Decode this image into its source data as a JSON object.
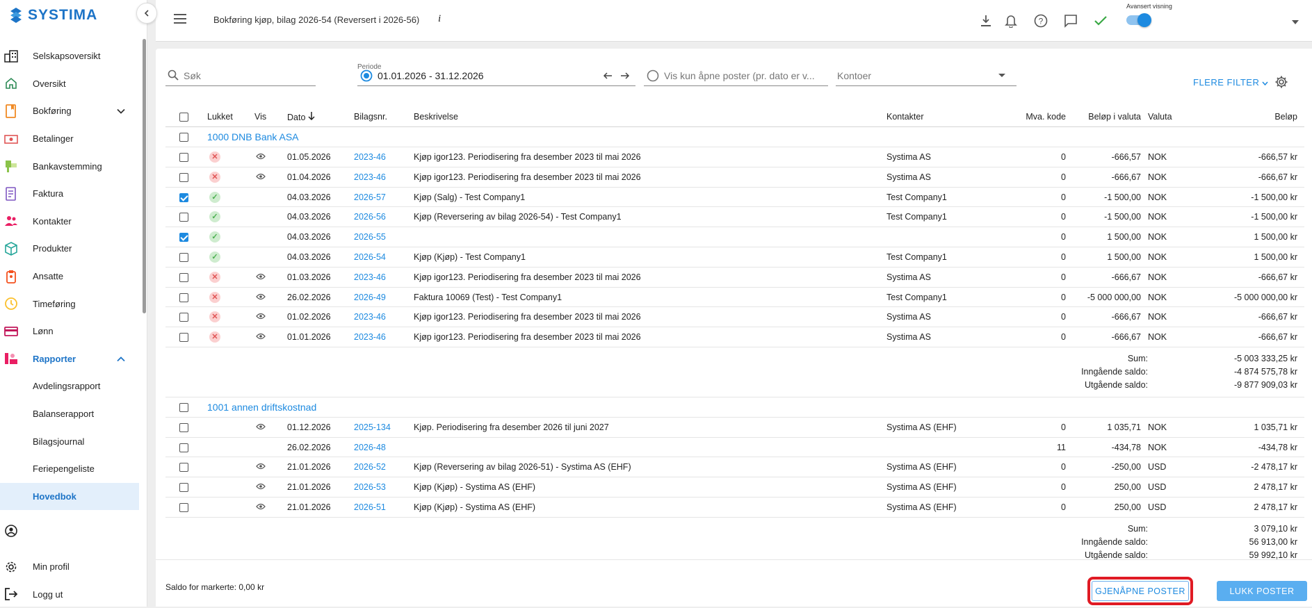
{
  "app": {
    "logo_text": "SYSTIMA"
  },
  "sidebar": {
    "items": [
      {
        "label": "Selskapsoversikt",
        "icon": "buildings-icon",
        "color": "#222222"
      },
      {
        "label": "Oversikt",
        "icon": "home-icon",
        "color": "#2e8b57"
      },
      {
        "label": "Bokføring",
        "icon": "book-icon",
        "color": "#f08a24"
      },
      {
        "label": "Betalinger",
        "icon": "money-icon",
        "color": "#e05555"
      },
      {
        "label": "Bankavstemming",
        "icon": "bank-icon",
        "color": "#8bc34a"
      },
      {
        "label": "Faktura",
        "icon": "invoice-icon",
        "color": "#7e57c2"
      },
      {
        "label": "Kontakter",
        "icon": "people-icon",
        "color": "#e91e63"
      },
      {
        "label": "Produkter",
        "icon": "box-icon",
        "color": "#26a69a"
      },
      {
        "label": "Ansatte",
        "icon": "badge-icon",
        "color": "#f4511e"
      },
      {
        "label": "Timeføring",
        "icon": "clock-icon",
        "color": "#fbc02d"
      },
      {
        "label": "Lønn",
        "icon": "card-icon",
        "color": "#c2185b"
      },
      {
        "label": "Rapporter",
        "icon": "report-icon",
        "color": "#e91e63"
      }
    ],
    "sub_items": [
      "Avdelingsrapport",
      "Balanserapport",
      "Bilagsjournal",
      "Feriepengeliste",
      "Hovedbok"
    ],
    "bottom": [
      {
        "label": "Min profil",
        "icon": "gear-icon"
      },
      {
        "label": "Logg ut",
        "icon": "logout-icon"
      }
    ]
  },
  "header": {
    "title": "Bokføring kjøp, bilag 2026-54 (Reversert i 2026-56)",
    "info": "i",
    "advanced_label": "Avansert visning"
  },
  "filters": {
    "search_placeholder": "Søk",
    "period_label": "Periode",
    "period_value": "01.01.2026 - 31.12.2026",
    "open_posts_placeholder": "Vis kun åpne poster (pr. dato er v...",
    "accounts_placeholder": "Kontoer",
    "more_filters": "FLERE FILTER"
  },
  "table": {
    "headers": [
      "Lukket",
      "Vis",
      "Dato",
      "Bilagsnr.",
      "Beskrivelse",
      "Kontakter",
      "Mva. kode",
      "Beløp i valuta",
      "Valuta",
      "Beløp"
    ],
    "groups": [
      {
        "title": "1000 DNB Bank ASA",
        "rows": [
          {
            "checked": false,
            "status": "x",
            "vis": true,
            "date": "01.05.2026",
            "voucher": "2023-46",
            "desc": "Kjøp igor123. Periodisering fra desember 2023 til mai 2026",
            "contact": "Systima AS",
            "vat": "0",
            "amount_cur": "-666,57",
            "currency": "NOK",
            "amount": "-666,57 kr"
          },
          {
            "checked": false,
            "status": "x",
            "vis": true,
            "date": "01.04.2026",
            "voucher": "2023-46",
            "desc": "Kjøp igor123. Periodisering fra desember 2023 til mai 2026",
            "contact": "Systima AS",
            "vat": "0",
            "amount_cur": "-666,67",
            "currency": "NOK",
            "amount": "-666,67 kr"
          },
          {
            "checked": true,
            "status": "ok",
            "vis": false,
            "date": "04.03.2026",
            "voucher": "2026-57",
            "desc": "Kjøp (Salg) - Test Company1",
            "contact": "Test Company1",
            "vat": "0",
            "amount_cur": "-1 500,00",
            "currency": "NOK",
            "amount": "-1 500,00 kr"
          },
          {
            "checked": false,
            "status": "ok",
            "vis": false,
            "date": "04.03.2026",
            "voucher": "2026-56",
            "desc": "Kjøp (Reversering av bilag 2026-54) - Test Company1",
            "contact": "Test Company1",
            "vat": "0",
            "amount_cur": "-1 500,00",
            "currency": "NOK",
            "amount": "-1 500,00 kr"
          },
          {
            "checked": true,
            "status": "ok",
            "vis": false,
            "date": "04.03.2026",
            "voucher": "2026-55",
            "desc": "",
            "contact": "",
            "vat": "0",
            "amount_cur": "1 500,00",
            "currency": "NOK",
            "amount": "1 500,00 kr"
          },
          {
            "checked": false,
            "status": "ok",
            "vis": false,
            "date": "04.03.2026",
            "voucher": "2026-54",
            "desc": "Kjøp (Kjøp) - Test Company1",
            "contact": "Test Company1",
            "vat": "0",
            "amount_cur": "1 500,00",
            "currency": "NOK",
            "amount": "1 500,00 kr"
          },
          {
            "checked": false,
            "status": "x",
            "vis": true,
            "date": "01.03.2026",
            "voucher": "2023-46",
            "desc": "Kjøp igor123. Periodisering fra desember 2023 til mai 2026",
            "contact": "Systima AS",
            "vat": "0",
            "amount_cur": "-666,67",
            "currency": "NOK",
            "amount": "-666,67 kr"
          },
          {
            "checked": false,
            "status": "x",
            "vis": true,
            "date": "26.02.2026",
            "voucher": "2026-49",
            "desc": "Faktura 10069 (Test) - Test Company1",
            "contact": "Test Company1",
            "vat": "0",
            "amount_cur": "-5 000 000,00",
            "currency": "NOK",
            "amount": "-5 000 000,00 kr"
          },
          {
            "checked": false,
            "status": "x",
            "vis": true,
            "date": "01.02.2026",
            "voucher": "2023-46",
            "desc": "Kjøp igor123. Periodisering fra desember 2023 til mai 2026",
            "contact": "Systima AS",
            "vat": "0",
            "amount_cur": "-666,67",
            "currency": "NOK",
            "amount": "-666,67 kr"
          },
          {
            "checked": false,
            "status": "x",
            "vis": true,
            "date": "01.01.2026",
            "voucher": "2023-46",
            "desc": "Kjøp igor123. Periodisering fra desember 2023 til mai 2026",
            "contact": "Systima AS",
            "vat": "0",
            "amount_cur": "-666,67",
            "currency": "NOK",
            "amount": "-666,67 kr"
          }
        ],
        "totals": [
          {
            "label": "Sum:",
            "value": "-5 003 333,25 kr"
          },
          {
            "label": "Inngående saldo:",
            "value": "-4 874 575,78 kr"
          },
          {
            "label": "Utgående saldo:",
            "value": "-9 877 909,03 kr"
          }
        ]
      },
      {
        "title": "1001 annen driftskostnad",
        "rows": [
          {
            "checked": false,
            "status": "",
            "vis": true,
            "date": "01.12.2026",
            "voucher": "2025-134",
            "desc": "Kjøp. Periodisering fra desember 2026 til juni 2027",
            "contact": "Systima AS (EHF)",
            "vat": "0",
            "amount_cur": "1 035,71",
            "currency": "NOK",
            "amount": "1 035,71 kr"
          },
          {
            "checked": false,
            "status": "",
            "vis": false,
            "date": "26.02.2026",
            "voucher": "2026-48",
            "desc": "",
            "contact": "",
            "vat": "11",
            "amount_cur": "-434,78",
            "currency": "NOK",
            "amount": "-434,78 kr"
          },
          {
            "checked": false,
            "status": "",
            "vis": true,
            "date": "21.01.2026",
            "voucher": "2026-52",
            "desc": "Kjøp (Reversering av bilag 2026-51) - Systima AS (EHF)",
            "contact": "Systima AS (EHF)",
            "vat": "0",
            "amount_cur": "-250,00",
            "currency": "USD",
            "amount": "-2 478,17 kr"
          },
          {
            "checked": false,
            "status": "",
            "vis": true,
            "date": "21.01.2026",
            "voucher": "2026-53",
            "desc": "Kjøp (Kjøp) - Systima AS (EHF)",
            "contact": "Systima AS (EHF)",
            "vat": "0",
            "amount_cur": "250,00",
            "currency": "USD",
            "amount": "2 478,17 kr"
          },
          {
            "checked": false,
            "status": "",
            "vis": true,
            "date": "21.01.2026",
            "voucher": "2026-51",
            "desc": "Kjøp (Kjøp) - Systima AS (EHF)",
            "contact": "Systima AS (EHF)",
            "vat": "0",
            "amount_cur": "250,00",
            "currency": "USD",
            "amount": "2 478,17 kr"
          }
        ],
        "totals": [
          {
            "label": "Sum:",
            "value": "3 079,10 kr"
          },
          {
            "label": "Inngående saldo:",
            "value": "56 913,00 kr"
          },
          {
            "label": "Utgående saldo:",
            "value": "59 992,10 kr"
          }
        ]
      }
    ]
  },
  "footer": {
    "saldo_text": "Saldo for markerte: 0,00 kr",
    "reopen_button": "GJENÅPNE POSTER",
    "close_button": "LUKK POSTER"
  },
  "colors": {
    "accent": "#1d8ae0",
    "highlight": "#e01b24"
  }
}
